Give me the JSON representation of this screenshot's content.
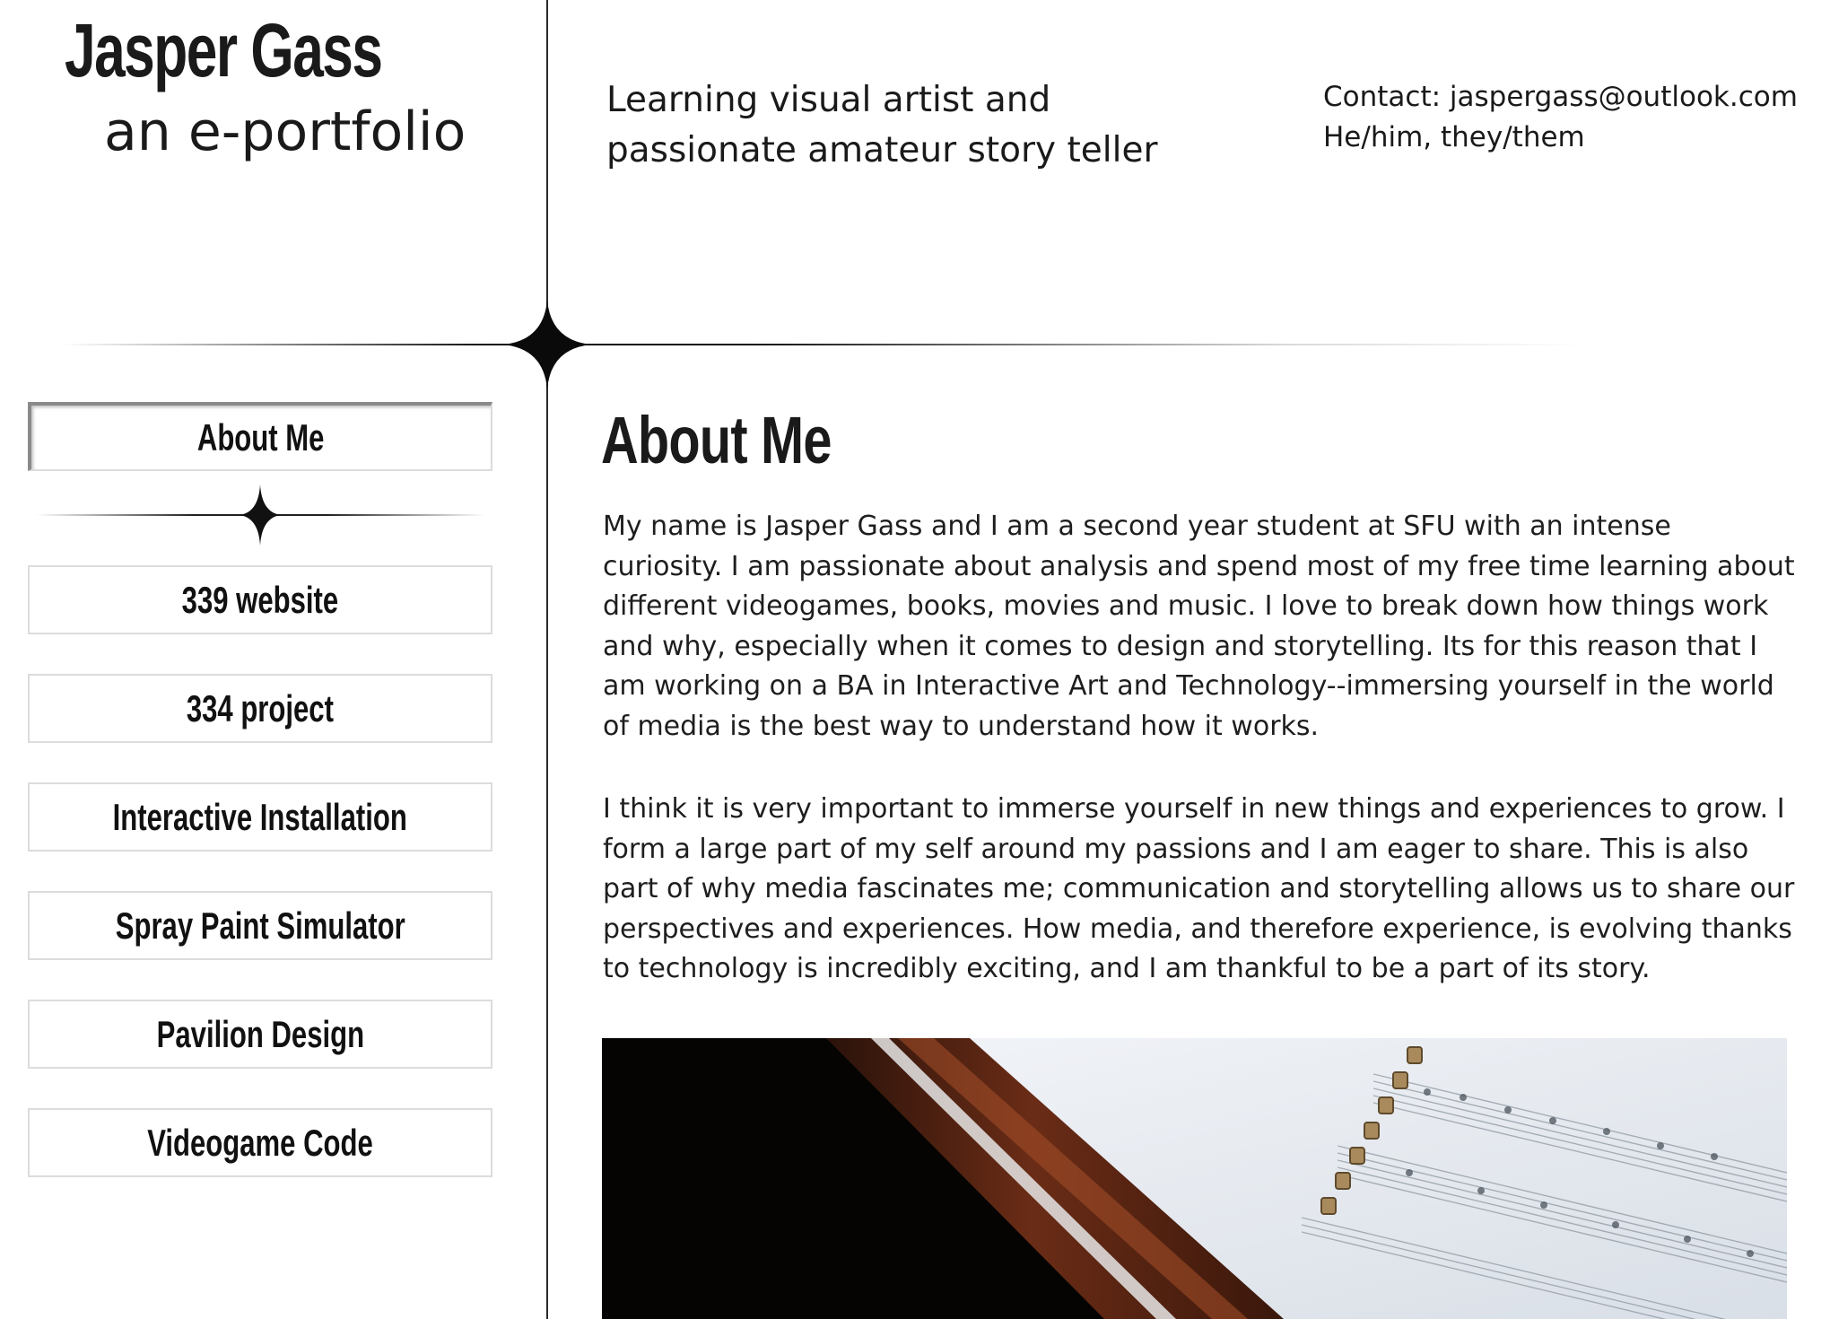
{
  "header": {
    "title": "Jasper Gass",
    "subtitle": "an e-portfolio",
    "tagline": "Learning visual artist and passionate amateur story teller",
    "contact_line": "Contact: jaspergass@outlook.com",
    "pronouns": "He/him, they/them"
  },
  "sidebar": {
    "items": [
      {
        "label": "About Me",
        "active": true
      },
      {
        "label": "339 website"
      },
      {
        "label": "334 project"
      },
      {
        "label": "Interactive Installation"
      },
      {
        "label": "Spray Paint Simulator"
      },
      {
        "label": "Pavilion Design"
      },
      {
        "label": "Videogame Code"
      }
    ]
  },
  "main": {
    "section_title": "About Me",
    "paragraphs": [
      "My name is Jasper Gass and I am a second year student at SFU with an intense curiosity. I am passionate about analysis and spend most of my free time learning about different videogames, books, movies and music. I love to break down how things work and why, especially when it comes to design and storytelling. Its for this reason that I am working on a BA in Interactive Art and Technology--immersing yourself in the world of media is the best way to understand how it works.",
      "I think it is very important to immerse yourself in new things and experiences to grow. I form a large part of my self around my passions and I am eager to share. This is also part of why media fascinates me; communication and storytelling allows us to share our perspectives and experiences. How media, and therefore experience, is evolving thanks to technology is incredibly exciting, and I am thankful to be a part of its story."
    ]
  },
  "colors": {
    "text": "#1a1a1a",
    "divider": "#2a2a2a",
    "nav_border": "#dcdcdc"
  }
}
